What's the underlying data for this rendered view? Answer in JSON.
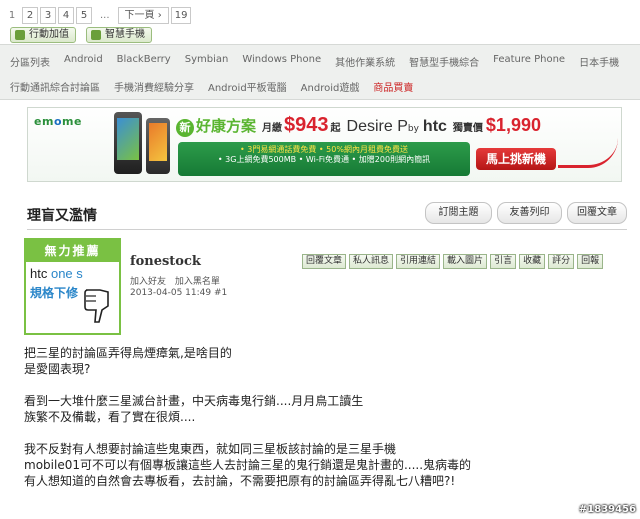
{
  "pager": {
    "pages": [
      "1",
      "2",
      "3",
      "4",
      "5"
    ],
    "ellipsis": "...",
    "next": "下一頁 ›",
    "last": "19"
  },
  "quick_buttons": [
    "行動加值",
    "智慧手機"
  ],
  "categories_row1": [
    "分區列表",
    "Android",
    "BlackBerry",
    "Symbian",
    "Windows Phone",
    "其他作業系統",
    "智慧型手機綜合",
    "Feature Phone",
    "日本手機"
  ],
  "categories_row2": [
    "行動通訊綜合討論區",
    "手機消費經驗分享",
    "Android平板電腦",
    "Android遊戲",
    "商品買賣"
  ],
  "banner": {
    "logo_a": "em",
    "logo_b": "o",
    "logo_c": "me",
    "new_badge": "新",
    "plan": "好康方案",
    "monthly": "月繳",
    "price": "$943",
    "from": "起",
    "model": "Desire P",
    "by": "by",
    "brand": "htc",
    "exclusive": "獨賣價",
    "price2": "$1,990",
    "line1": "• 3門易網通話費免費   • 50%網內月租費免費送",
    "line2": "• 3G上網免費500MB   • Wi-Fi免費通   • 加贈200則網內簡訊",
    "cta": "馬上挑新機"
  },
  "thread": {
    "title": "理盲又濫情",
    "buttons": [
      "訂閱主題",
      "友善列印",
      "回覆文章"
    ]
  },
  "avatar": {
    "top": "無力推薦",
    "htc": "htc",
    "ones": "one s",
    "line1": "規格下修"
  },
  "post": {
    "username": "fonestock",
    "links": [
      "加入好友",
      "加入黑名單"
    ],
    "date": "2013-04-05 11:49",
    "floor": "#1",
    "actions": [
      "回覆文章",
      "私人訊息",
      "引用連結",
      "載入圖片",
      "引言",
      "收藏",
      "評分",
      "回報"
    ],
    "lines": [
      "把三星的討論區弄得烏煙瘴氣,是啥目的",
      "是愛國表現?",
      "",
      "看到一大堆什麼三星滅台計畫，中天病毒鬼行銷....月月鳥工讀生",
      "族繁不及備載，看了實在很煩....",
      "",
      "我不反對有人想要討論這些鬼東西，就如同三星板該討論的是三星手機",
      "mobile01可不可以有個專板讓這些人去討論三星的鬼行銷還是鬼計畫的.....鬼病毒的",
      "有人想知道的自然會去專板看，去討論，不需要把原有的討論區弄得亂七八糟吧?!"
    ]
  },
  "watermark": "#1839456"
}
